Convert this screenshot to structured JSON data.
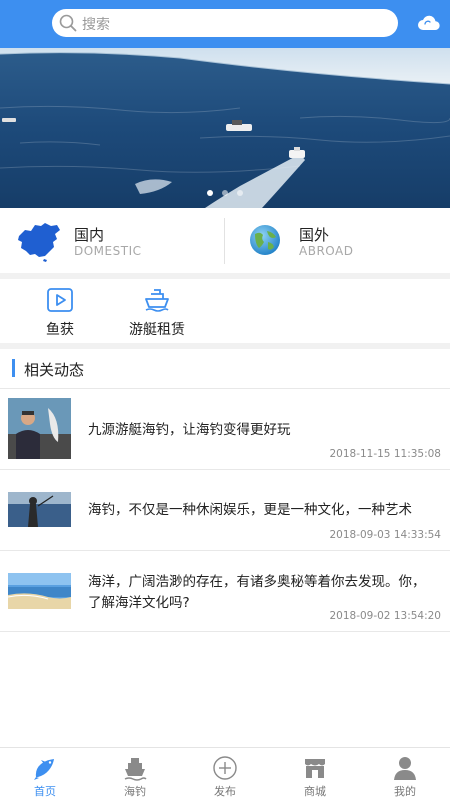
{
  "search": {
    "placeholder": "搜索"
  },
  "header": {
    "cloud_icon": "cloud-icon"
  },
  "banner": {
    "slide_count": 3,
    "active_index": 0
  },
  "categories": [
    {
      "title": "国内",
      "subtitle": "DOMESTIC",
      "icon": "china-map-icon"
    },
    {
      "title": "国外",
      "subtitle": "ABROAD",
      "icon": "globe-icon"
    }
  ],
  "quick_links": [
    {
      "label": "鱼获",
      "icon": "video-play-icon"
    },
    {
      "label": "游艇租赁",
      "icon": "yacht-icon"
    }
  ],
  "section": {
    "title": "相关动态"
  },
  "news": [
    {
      "title": "九源游艇海钓，让海钓变得更好玩",
      "date": "2018-11-15 11:35:08"
    },
    {
      "title": "海钓，不仅是一种休闲娱乐，更是一种文化，一种艺术",
      "date": "2018-09-03 14:33:54"
    },
    {
      "title": "海洋，广阔浩渺的存在，有诸多奥秘等着你去发现。你，了解海洋文化吗?",
      "date": "2018-09-02 13:54:20"
    }
  ],
  "tabs": [
    {
      "label": "首页",
      "icon": "fish-icon",
      "active": true
    },
    {
      "label": "海钓",
      "icon": "fishing-boat-icon",
      "active": false
    },
    {
      "label": "发布",
      "icon": "plus-circle-icon",
      "active": false
    },
    {
      "label": "商城",
      "icon": "store-icon",
      "active": false
    },
    {
      "label": "我的",
      "icon": "user-icon",
      "active": false
    }
  ],
  "colors": {
    "primary": "#3d8ff0",
    "sea": "#1c4a7a"
  }
}
